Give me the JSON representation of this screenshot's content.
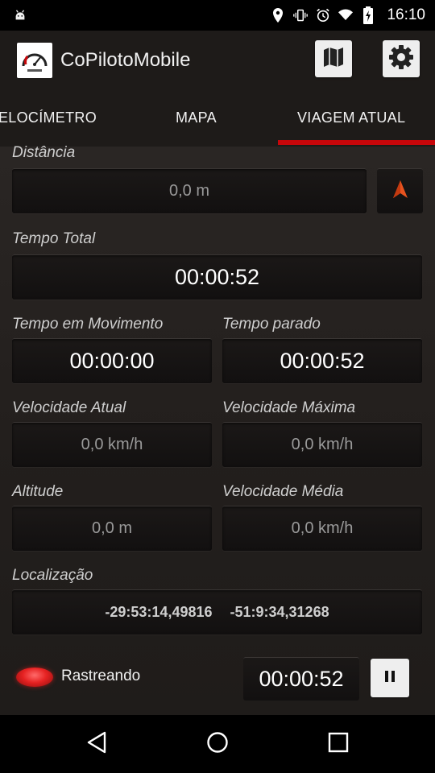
{
  "status_bar": {
    "time": "16:10",
    "left_icon": "android-debug-icon",
    "icons": [
      "location-icon",
      "vibrate-icon",
      "alarm-icon",
      "wifi-icon",
      "battery-charging-icon"
    ]
  },
  "app_bar": {
    "title": "CoPilotoMobile",
    "map_button_icon": "map-icon",
    "settings_button_icon": "gear-icon"
  },
  "tabs": [
    {
      "label": "ELOCÍMETRO",
      "selected": false
    },
    {
      "label": "MAPA",
      "selected": false
    },
    {
      "label": "VIAGEM ATUAL",
      "selected": true
    }
  ],
  "colors": {
    "accent": "#c7060a",
    "background": "#231f1d",
    "appbar": "#1e1b19"
  },
  "trip": {
    "distance": {
      "label": "Distância",
      "value": "0,0 m"
    },
    "total_time": {
      "label": "Tempo Total",
      "value": "00:00:52"
    },
    "moving_time": {
      "label": "Tempo em Movimento",
      "value": "00:00:00"
    },
    "stopped_time": {
      "label": "Tempo parado",
      "value": "00:00:52"
    },
    "current_speed": {
      "label": "Velocidade Atual",
      "value": "0,0 km/h"
    },
    "max_speed": {
      "label": "Velocidade Máxima",
      "value": "0,0 km/h"
    },
    "altitude": {
      "label": "Altitude",
      "value": "0,0 m"
    },
    "avg_speed": {
      "label": "Velocidade Média",
      "value": "0,0 km/h"
    },
    "location": {
      "label": "Localização",
      "value": "-29:53:14,49816  -51:9:34,31268"
    }
  },
  "tracking": {
    "label": "Rastreando",
    "timer": "00:00:52",
    "pause_icon": "pause-icon"
  },
  "nav_bar": {
    "icons": [
      "back-icon",
      "home-icon",
      "recents-icon"
    ]
  }
}
